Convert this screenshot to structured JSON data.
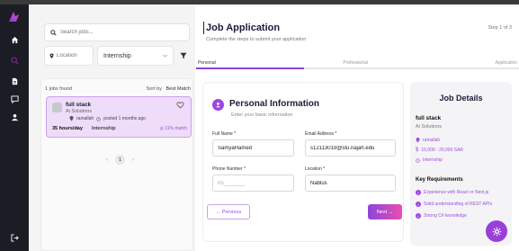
{
  "colors": {
    "accent": "#9b4fd9",
    "accent_dark": "#8e44d9",
    "pink": "#e64fb1",
    "rail_bg": "#1c1c24",
    "card_bg": "#eedcf9"
  },
  "rail": {
    "icons": [
      "logo-icon",
      "home-icon",
      "search-icon",
      "document-icon",
      "chat-icon",
      "user-icon",
      "logout-icon"
    ]
  },
  "search": {
    "placeholder": "Search jobs..."
  },
  "filters": {
    "location_placeholder": "Location",
    "job_type": "Internship"
  },
  "list": {
    "count_label": "1 jobs found",
    "sort_label": "Sort by",
    "sort_value": "Best Match",
    "jobs": [
      {
        "title": "full stack",
        "company": "Ai Solutions",
        "location": "ramallah",
        "posted": "posted 1 months ago",
        "hours": "35 hours/day",
        "type": "Internship",
        "match": "11% match"
      }
    ],
    "pager": {
      "prev": "‹",
      "page": "1",
      "next": "›"
    }
  },
  "application": {
    "title": "Job Application",
    "subtitle": "Complete the steps to submit your application",
    "step_info": "Step 1 of 3",
    "steps": [
      "Personal",
      "Professional",
      "Application"
    ],
    "progress": 0.333
  },
  "form": {
    "section_title": "Personal Information",
    "section_subtitle": "Enter your basic information",
    "full_name_label": "Full Name *",
    "full_name_value": "SamyaHamed",
    "email_label": "Email Address *",
    "email_value": "s12113019@stu.najah.edu",
    "phone_label": "Phone Number *",
    "phone_placeholder": "05_______",
    "location_label": "Location *",
    "location_value": "Nablus",
    "prev_label": "← Previous",
    "next_label": "Next →"
  },
  "details": {
    "title": "Job Details",
    "job_title": "full stack",
    "company": "Ai Solutions",
    "location": "ramallah",
    "salary": "15,000 - 20,000 SAR",
    "type": "Internship",
    "requirements_title": "Key Requirements",
    "requirements": [
      "Experience with React or Next.js",
      "Solid understanding of REST APIs",
      "Strong C# knowledge"
    ]
  }
}
